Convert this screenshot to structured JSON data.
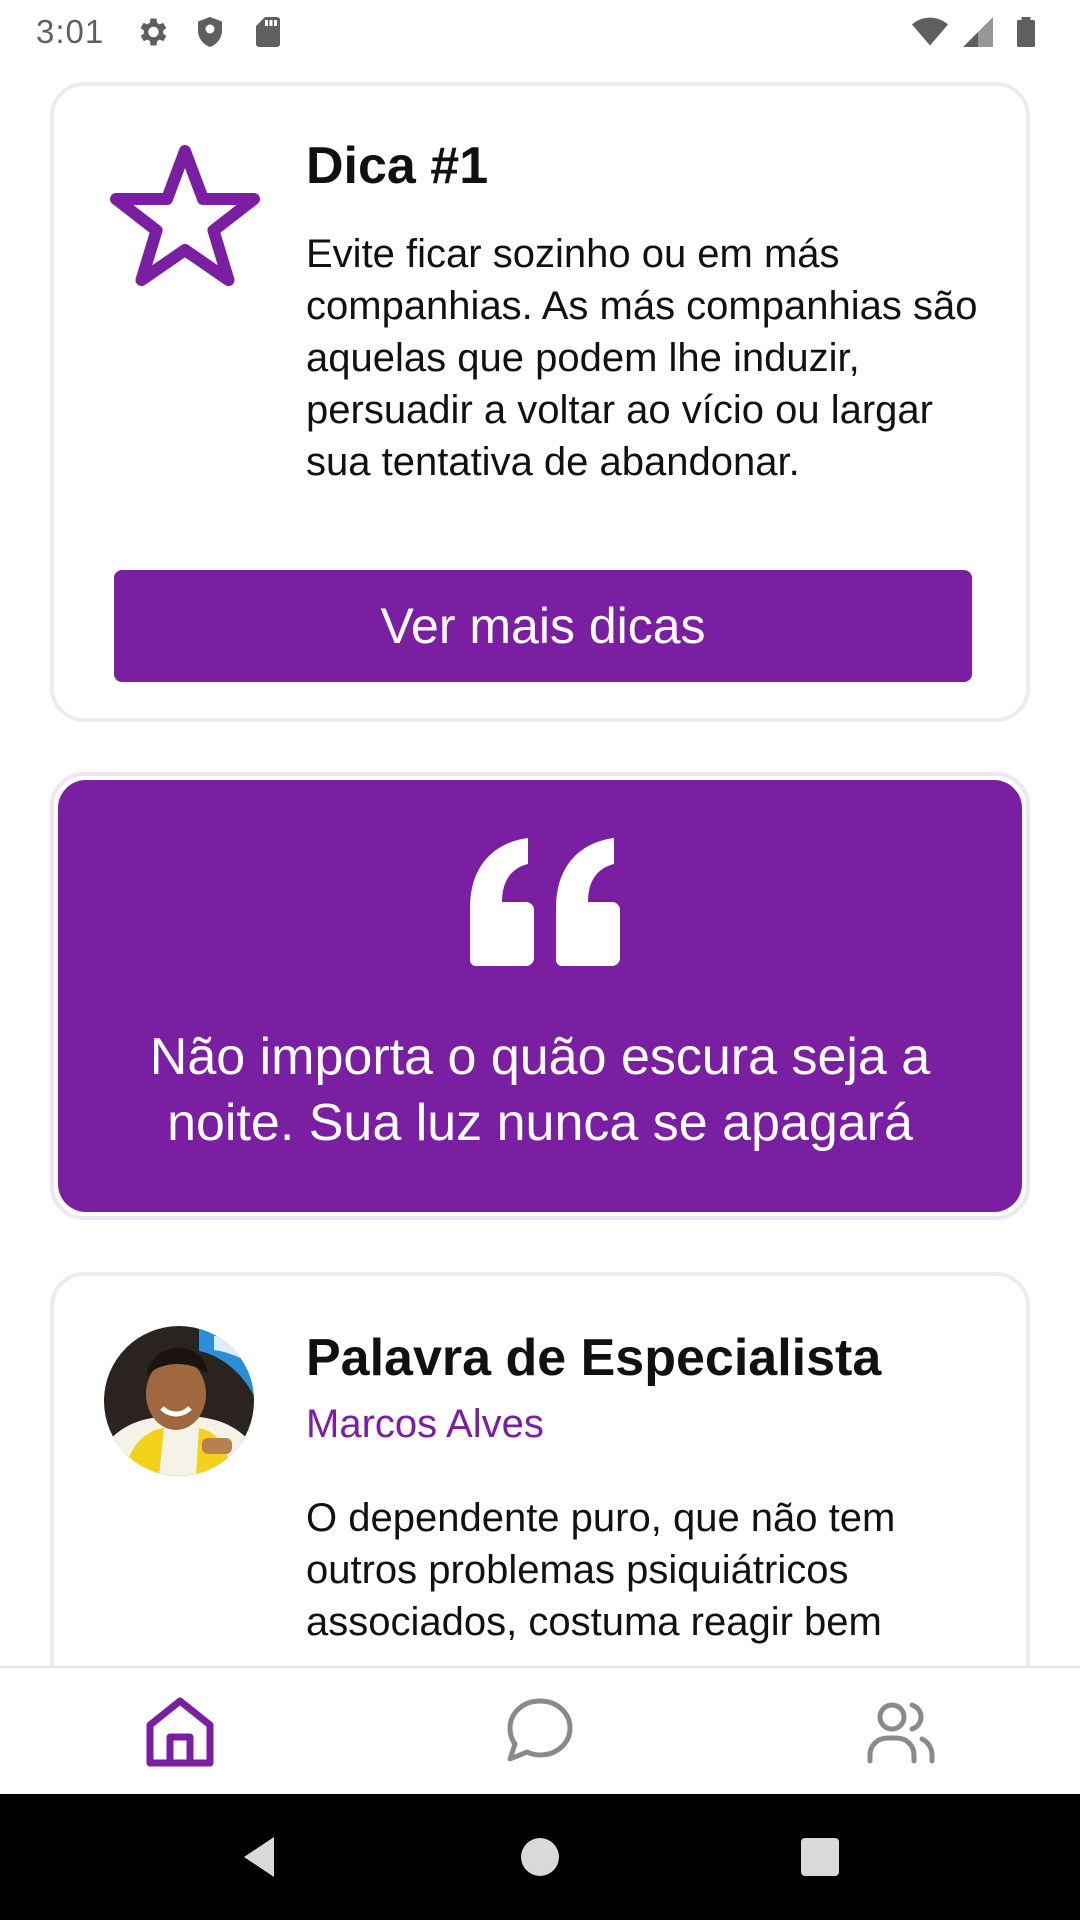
{
  "status_bar": {
    "time": "3:01",
    "left_icons": [
      "gear-icon",
      "shield-icon",
      "sd-card-icon"
    ],
    "right_icons": [
      "wifi-icon",
      "signal-icon",
      "battery-icon"
    ]
  },
  "tip": {
    "icon": "star-outline-icon",
    "title": "Dica #1",
    "body": "Evite ficar sozinho ou em más companhias. As más companhias são aquelas que podem lhe induzir, persuadir a voltar ao vício ou largar sua tentativa de abandonar.",
    "button_label": "Ver mais dicas"
  },
  "quote": {
    "icon": "quote-icon",
    "text": "Não importa o quão escura seja a noite. Sua luz nunca se apagará"
  },
  "specialist": {
    "title": "Palavra de Especialista",
    "name": "Marcos Alves",
    "body": "O dependente puro, que não tem outros problemas psiquiátricos associados, costuma reagir bem"
  },
  "bottom_nav": {
    "items": [
      {
        "icon": "home-icon",
        "active": true
      },
      {
        "icon": "chat-icon",
        "active": false
      },
      {
        "icon": "users-icon",
        "active": false
      }
    ]
  },
  "colors": {
    "accent": "#7a1fa2",
    "card_border": "#ececec",
    "inactive_icon": "#8a8a8a",
    "status_text": "#5f5f5f"
  },
  "system_nav": [
    "back-icon",
    "home-circle-icon",
    "recents-icon"
  ]
}
